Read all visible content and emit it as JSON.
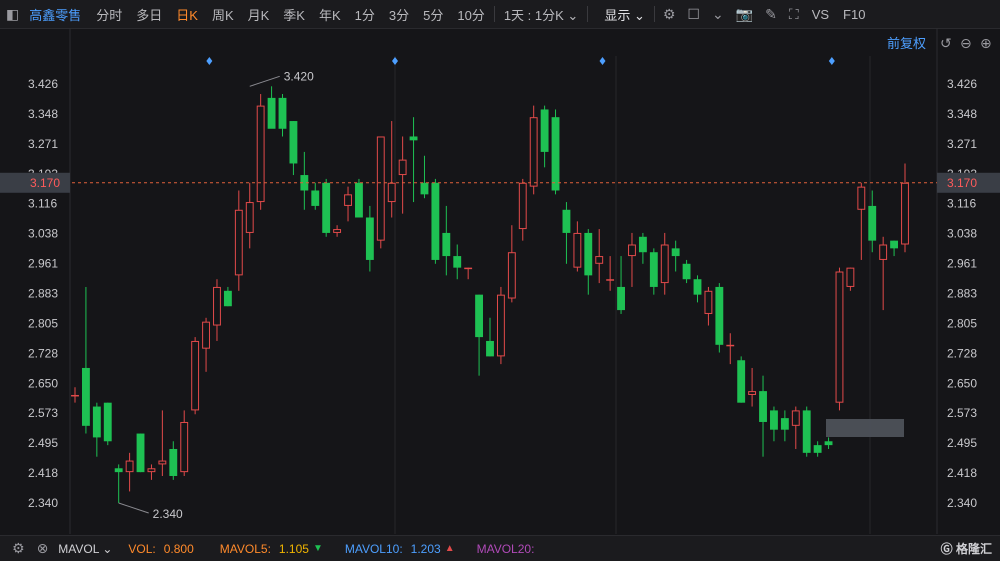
{
  "toolbar": {
    "stock_name": "高鑫零售",
    "periods": [
      "分时",
      "多日",
      "日K",
      "周K",
      "月K",
      "季K",
      "年K",
      "1分",
      "3分",
      "5分",
      "10分"
    ],
    "active_period": "日K",
    "period_select": "1天 : 1分K",
    "display_label": "显示",
    "vs_label": "VS",
    "f10_label": "F10"
  },
  "adjust_label": "前复权",
  "y_ticks": [
    "3.426",
    "3.348",
    "3.271",
    "3.193",
    "3.116",
    "3.038",
    "2.961",
    "2.883",
    "2.805",
    "2.728",
    "2.650",
    "2.573",
    "2.495",
    "2.418",
    "2.340"
  ],
  "current_price_label": "3.170",
  "max_label": "3.420",
  "min_label": "2.340",
  "footer": {
    "indicator": "MAVOL",
    "vol_label": "VOL:",
    "vol_value": "0.800",
    "mavol5_label": "MAVOL5:",
    "mavol5_value": "1.105",
    "mavol10_label": "MAVOL10:",
    "mavol10_value": "1.203",
    "mavol20_label": "MAVOL20:"
  },
  "colors": {
    "up": "#e24a4a",
    "down": "#1ec153",
    "accent": "#ff8a2b",
    "link": "#4d9fff"
  },
  "chart_data": {
    "type": "candlestick",
    "ylim": [
      2.31,
      3.47
    ],
    "current_price": 3.17,
    "max": {
      "value": 3.42,
      "index": 16
    },
    "min": {
      "value": 2.34,
      "index": 4
    },
    "candles": [
      {
        "o": 2.62,
        "h": 2.64,
        "l": 2.6,
        "c": 2.62
      },
      {
        "o": 2.69,
        "h": 2.9,
        "l": 2.52,
        "c": 2.54
      },
      {
        "o": 2.59,
        "h": 2.6,
        "l": 2.46,
        "c": 2.51
      },
      {
        "o": 2.6,
        "h": 2.6,
        "l": 2.49,
        "c": 2.5
      },
      {
        "o": 2.43,
        "h": 2.44,
        "l": 2.34,
        "c": 2.42
      },
      {
        "o": 2.42,
        "h": 2.47,
        "l": 2.37,
        "c": 2.45
      },
      {
        "o": 2.52,
        "h": 2.52,
        "l": 2.42,
        "c": 2.42
      },
      {
        "o": 2.42,
        "h": 2.44,
        "l": 2.4,
        "c": 2.43
      },
      {
        "o": 2.44,
        "h": 2.58,
        "l": 2.41,
        "c": 2.45
      },
      {
        "o": 2.48,
        "h": 2.5,
        "l": 2.4,
        "c": 2.41
      },
      {
        "o": 2.42,
        "h": 2.58,
        "l": 2.41,
        "c": 2.55
      },
      {
        "o": 2.58,
        "h": 2.77,
        "l": 2.57,
        "c": 2.76
      },
      {
        "o": 2.74,
        "h": 2.82,
        "l": 2.68,
        "c": 2.81
      },
      {
        "o": 2.8,
        "h": 2.92,
        "l": 2.76,
        "c": 2.9
      },
      {
        "o": 2.89,
        "h": 2.9,
        "l": 2.85,
        "c": 2.85
      },
      {
        "o": 2.93,
        "h": 3.15,
        "l": 2.89,
        "c": 3.1
      },
      {
        "o": 3.04,
        "h": 3.17,
        "l": 3.0,
        "c": 3.12
      },
      {
        "o": 3.12,
        "h": 3.4,
        "l": 3.1,
        "c": 3.37
      },
      {
        "o": 3.39,
        "h": 3.42,
        "l": 3.33,
        "c": 3.31
      },
      {
        "o": 3.39,
        "h": 3.4,
        "l": 3.29,
        "c": 3.31
      },
      {
        "o": 3.33,
        "h": 3.33,
        "l": 3.19,
        "c": 3.22
      },
      {
        "o": 3.19,
        "h": 3.25,
        "l": 3.1,
        "c": 3.15
      },
      {
        "o": 3.15,
        "h": 3.17,
        "l": 3.1,
        "c": 3.11
      },
      {
        "o": 3.17,
        "h": 3.18,
        "l": 3.03,
        "c": 3.04
      },
      {
        "o": 3.04,
        "h": 3.06,
        "l": 3.03,
        "c": 3.05
      },
      {
        "o": 3.11,
        "h": 3.16,
        "l": 3.07,
        "c": 3.14
      },
      {
        "o": 3.17,
        "h": 3.18,
        "l": 3.08,
        "c": 3.08
      },
      {
        "o": 3.08,
        "h": 3.11,
        "l": 2.94,
        "c": 2.97
      },
      {
        "o": 3.02,
        "h": 3.29,
        "l": 3.0,
        "c": 3.29
      },
      {
        "o": 3.12,
        "h": 3.33,
        "l": 3.08,
        "c": 3.17
      },
      {
        "o": 3.19,
        "h": 3.29,
        "l": 3.09,
        "c": 3.23
      },
      {
        "o": 3.29,
        "h": 3.34,
        "l": 3.12,
        "c": 3.28
      },
      {
        "o": 3.17,
        "h": 3.24,
        "l": 3.13,
        "c": 3.14
      },
      {
        "o": 3.17,
        "h": 3.18,
        "l": 2.96,
        "c": 2.97
      },
      {
        "o": 3.04,
        "h": 3.11,
        "l": 2.93,
        "c": 2.98
      },
      {
        "o": 2.98,
        "h": 3.01,
        "l": 2.92,
        "c": 2.95
      },
      {
        "o": 2.95,
        "h": 2.95,
        "l": 2.92,
        "c": 2.95
      },
      {
        "o": 2.88,
        "h": 2.88,
        "l": 2.67,
        "c": 2.77
      },
      {
        "o": 2.76,
        "h": 2.82,
        "l": 2.72,
        "c": 2.72
      },
      {
        "o": 2.72,
        "h": 2.9,
        "l": 2.7,
        "c": 2.88
      },
      {
        "o": 2.87,
        "h": 3.06,
        "l": 2.86,
        "c": 2.99
      },
      {
        "o": 3.05,
        "h": 3.18,
        "l": 3.02,
        "c": 3.17
      },
      {
        "o": 3.16,
        "h": 3.37,
        "l": 3.14,
        "c": 3.34
      },
      {
        "o": 3.36,
        "h": 3.37,
        "l": 3.21,
        "c": 3.25
      },
      {
        "o": 3.34,
        "h": 3.36,
        "l": 3.14,
        "c": 3.15
      },
      {
        "o": 3.1,
        "h": 3.12,
        "l": 2.96,
        "c": 3.04
      },
      {
        "o": 2.95,
        "h": 3.07,
        "l": 2.94,
        "c": 3.04
      },
      {
        "o": 3.04,
        "h": 3.05,
        "l": 2.88,
        "c": 2.93
      },
      {
        "o": 2.96,
        "h": 3.05,
        "l": 2.91,
        "c": 2.98
      },
      {
        "o": 2.92,
        "h": 2.98,
        "l": 2.89,
        "c": 2.92
      },
      {
        "o": 2.9,
        "h": 2.98,
        "l": 2.83,
        "c": 2.84
      },
      {
        "o": 2.98,
        "h": 3.04,
        "l": 2.9,
        "c": 3.01
      },
      {
        "o": 3.03,
        "h": 3.04,
        "l": 2.96,
        "c": 2.99
      },
      {
        "o": 2.99,
        "h": 3.0,
        "l": 2.88,
        "c": 2.9
      },
      {
        "o": 2.91,
        "h": 3.04,
        "l": 2.88,
        "c": 3.01
      },
      {
        "o": 3.0,
        "h": 3.02,
        "l": 2.94,
        "c": 2.98
      },
      {
        "o": 2.96,
        "h": 2.97,
        "l": 2.91,
        "c": 2.92
      },
      {
        "o": 2.92,
        "h": 2.93,
        "l": 2.86,
        "c": 2.88
      },
      {
        "o": 2.83,
        "h": 2.9,
        "l": 2.8,
        "c": 2.89
      },
      {
        "o": 2.9,
        "h": 2.91,
        "l": 2.73,
        "c": 2.75
      },
      {
        "o": 2.75,
        "h": 2.78,
        "l": 2.7,
        "c": 2.75
      },
      {
        "o": 2.71,
        "h": 2.72,
        "l": 2.6,
        "c": 2.6
      },
      {
        "o": 2.62,
        "h": 2.69,
        "l": 2.59,
        "c": 2.63
      },
      {
        "o": 2.63,
        "h": 2.67,
        "l": 2.46,
        "c": 2.55
      },
      {
        "o": 2.58,
        "h": 2.59,
        "l": 2.5,
        "c": 2.53
      },
      {
        "o": 2.56,
        "h": 2.58,
        "l": 2.5,
        "c": 2.53
      },
      {
        "o": 2.54,
        "h": 2.59,
        "l": 2.48,
        "c": 2.58
      },
      {
        "o": 2.58,
        "h": 2.59,
        "l": 2.46,
        "c": 2.47
      },
      {
        "o": 2.49,
        "h": 2.5,
        "l": 2.46,
        "c": 2.47
      },
      {
        "o": 2.5,
        "h": 2.51,
        "l": 2.48,
        "c": 2.49
      },
      {
        "o": 2.6,
        "h": 2.95,
        "l": 2.58,
        "c": 2.94
      },
      {
        "o": 2.9,
        "h": 2.95,
        "l": 2.89,
        "c": 2.95
      },
      {
        "o": 3.1,
        "h": 3.17,
        "l": 2.97,
        "c": 3.16
      },
      {
        "o": 3.11,
        "h": 3.15,
        "l": 2.99,
        "c": 3.02
      },
      {
        "o": 2.97,
        "h": 3.03,
        "l": 2.84,
        "c": 3.01
      },
      {
        "o": 3.02,
        "h": 3.02,
        "l": 2.98,
        "c": 3.0
      },
      {
        "o": 3.01,
        "h": 3.22,
        "l": 2.99,
        "c": 3.17
      }
    ],
    "event_markers": [
      12,
      29,
      48,
      69
    ]
  }
}
